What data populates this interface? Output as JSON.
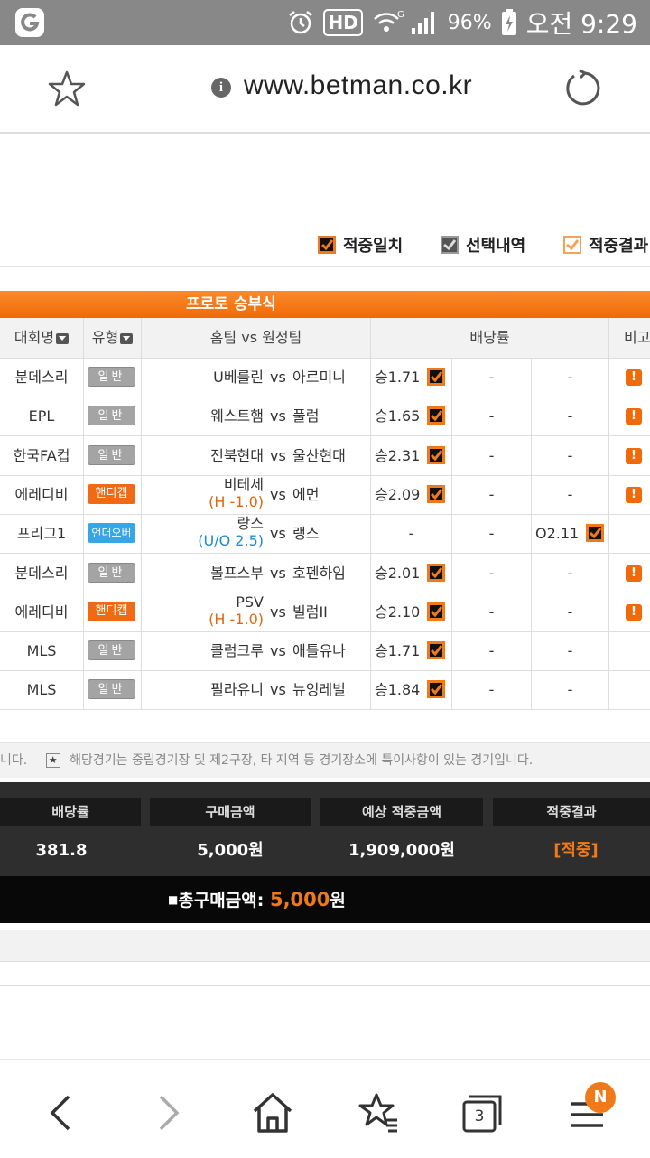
{
  "status_bar": {
    "hd_label": "HD",
    "network_label": "G",
    "battery": "96%",
    "time": "오전 9:29",
    "icons": [
      "app-icon",
      "alarm-icon",
      "hd-icon",
      "wifi-icon",
      "signal-icon",
      "battery-icon"
    ]
  },
  "browser": {
    "url": "www.betman.co.kr",
    "info_symbol": "i",
    "tab_count": "3",
    "menu_badge": "N"
  },
  "legend": {
    "match": "적중일치",
    "selected": "선택내역",
    "result": "적중결과"
  },
  "table": {
    "title": "프로토 승부식",
    "headers": {
      "league": "대회명",
      "type": "유형",
      "match": "홈팀 vs 원정팀",
      "odds": "배당률",
      "note": "비고"
    },
    "vs": "vs",
    "rows": [
      {
        "league": "분데스리",
        "type": "일반",
        "type_kind": "gen",
        "home": "U베를린",
        "home_sub": "",
        "away": "아르미니",
        "o1": "승1.71",
        "o2": "-",
        "o3": "-",
        "sel": 1,
        "warn": "!"
      },
      {
        "league": "EPL",
        "type": "일반",
        "type_kind": "gen",
        "home": "웨스트햄",
        "home_sub": "",
        "away": "풀럼",
        "o1": "승1.65",
        "o2": "-",
        "o3": "-",
        "sel": 1,
        "warn": "!"
      },
      {
        "league": "한국FA컵",
        "type": "일반",
        "type_kind": "gen",
        "home": "전북현대",
        "home_sub": "",
        "away": "울산현대",
        "o1": "승2.31",
        "o2": "-",
        "o3": "-",
        "sel": 1,
        "warn": "!"
      },
      {
        "league": "에레디비",
        "type": "핸디캡",
        "type_kind": "hc",
        "home": "비테세",
        "home_sub": "(H -1.0)",
        "away": "에먼",
        "o1": "승2.09",
        "o2": "-",
        "o3": "-",
        "sel": 1,
        "warn": "!"
      },
      {
        "league": "프리그1",
        "type": "언더오버",
        "type_kind": "uo",
        "home": "랑스",
        "home_sub": "(U/O 2.5)",
        "away": "랭스",
        "o1": "-",
        "o2": "-",
        "o3": "O2.11",
        "sel": 3,
        "warn": ""
      },
      {
        "league": "분데스리",
        "type": "일반",
        "type_kind": "gen",
        "home": "볼프스부",
        "home_sub": "",
        "away": "호펜하임",
        "o1": "승2.01",
        "o2": "-",
        "o3": "-",
        "sel": 1,
        "warn": "!"
      },
      {
        "league": "에레디비",
        "type": "핸디캡",
        "type_kind": "hc",
        "home": "PSV",
        "home_sub": "(H -1.0)",
        "away": "빌럼II",
        "o1": "승2.10",
        "o2": "-",
        "o3": "-",
        "sel": 1,
        "warn": "!"
      },
      {
        "league": "MLS",
        "type": "일반",
        "type_kind": "gen",
        "home": "콜럼크루",
        "home_sub": "",
        "away": "애틀유나",
        "o1": "승1.71",
        "o2": "-",
        "o3": "-",
        "sel": 1,
        "warn": ""
      },
      {
        "league": "MLS",
        "type": "일반",
        "type_kind": "gen",
        "home": "필라유니",
        "home_sub": "",
        "away": "뉴잉레벌",
        "o1": "승1.84",
        "o2": "-",
        "o3": "-",
        "sel": 1,
        "warn": ""
      }
    ],
    "note_prefix": "니다.",
    "note_star": "★",
    "note_text": "해당경기는 중립경기장 및 제2구장, 타 지역 등 경기장소에 특이사항이 있는 경기입니다."
  },
  "summary": {
    "odds_label": "배당률",
    "odds_value": "381.8",
    "purchase_label": "구매금액",
    "purchase_value": "5,000원",
    "expected_label": "예상 적중금액",
    "expected_value": "1,909,000원",
    "result_label": "적중결과",
    "result_value": "[적중]",
    "total_label": "총구매금액: ",
    "total_amount": "5,000",
    "total_unit": "원"
  },
  "colors": {
    "accent": "#f07a1a",
    "status_bar": "#888888",
    "summary_bg": "#2e2e2e"
  }
}
